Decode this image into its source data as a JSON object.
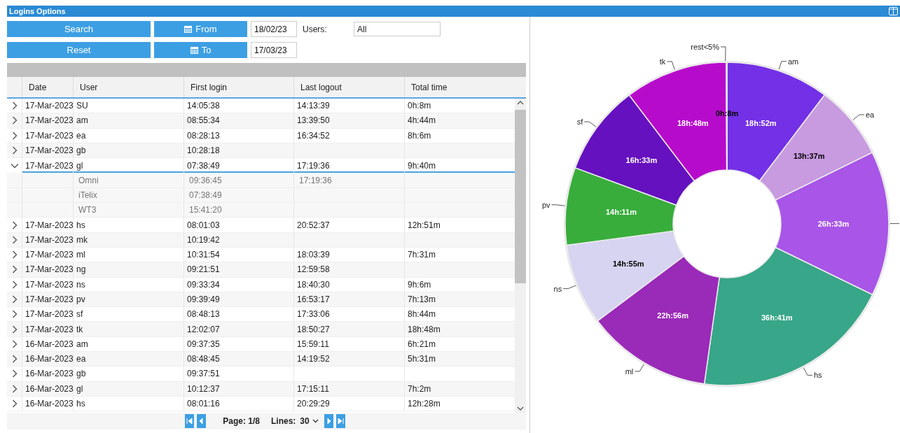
{
  "window": {
    "title": "Logins Options"
  },
  "filters": {
    "search_button": "Search",
    "reset_button": "Reset",
    "from_button": "From",
    "to_button": "To",
    "from_date": "18/02/23",
    "to_date": "17/03/23",
    "users_label": "Users:",
    "users_value": "All"
  },
  "table": {
    "columns": [
      "Date",
      "User",
      "First login",
      "Last logout",
      "Total time"
    ],
    "rows": [
      {
        "date": "17-Mar-2023",
        "user": "SU",
        "first_login": "14:05:38",
        "last_logout": "14:13:39",
        "total_time": "0h:8m",
        "expanded": false
      },
      {
        "date": "17-Mar-2023",
        "user": "am",
        "first_login": "08:55:34",
        "last_logout": "13:39:50",
        "total_time": "4h:44m",
        "expanded": false
      },
      {
        "date": "17-Mar-2023",
        "user": "ea",
        "first_login": "08:28:13",
        "last_logout": "16:34:52",
        "total_time": "8h:6m",
        "expanded": false
      },
      {
        "date": "17-Mar-2023",
        "user": "gb",
        "first_login": "10:28:18",
        "expanded": false
      },
      {
        "date": "17-Mar-2023",
        "user": "gl",
        "first_login": "07:38:49",
        "last_logout": "17:19:36",
        "total_time": "9h:40m",
        "expanded": true,
        "children": [
          {
            "user": "Omni",
            "first_login": "09:36:45",
            "last_logout": "17:19:36"
          },
          {
            "user": "iTelix",
            "first_login": "07:38:49"
          },
          {
            "user": "WT3",
            "first_login": "15:41:20"
          }
        ]
      },
      {
        "date": "17-Mar-2023",
        "user": "hs",
        "first_login": "08:01:03",
        "last_logout": "20:52:37",
        "total_time": "12h:51m",
        "expanded": false
      },
      {
        "date": "17-Mar-2023",
        "user": "mk",
        "first_login": "10:19:42",
        "expanded": false
      },
      {
        "date": "17-Mar-2023",
        "user": "ml",
        "first_login": "10:31:54",
        "last_logout": "18:03:39",
        "total_time": "7h:31m",
        "expanded": false
      },
      {
        "date": "17-Mar-2023",
        "user": "ng",
        "first_login": "09:21:51",
        "last_logout": "12:59:58",
        "expanded": false
      },
      {
        "date": "17-Mar-2023",
        "user": "ns",
        "first_login": "09:33:34",
        "last_logout": "18:40:30",
        "total_time": "9h:6m",
        "expanded": false
      },
      {
        "date": "17-Mar-2023",
        "user": "pv",
        "first_login": "09:39:49",
        "last_logout": "16:53:17",
        "total_time": "7h:13m",
        "expanded": false
      },
      {
        "date": "17-Mar-2023",
        "user": "sf",
        "first_login": "08:48:13",
        "last_logout": "17:33:06",
        "total_time": "8h:44m",
        "expanded": false
      },
      {
        "date": "17-Mar-2023",
        "user": "tk",
        "first_login": "12:02:07",
        "last_logout": "18:50:27",
        "total_time": "18h:48m",
        "expanded": false
      },
      {
        "date": "16-Mar-2023",
        "user": "am",
        "first_login": "09:37:35",
        "last_logout": "15:59:11",
        "total_time": "6h:21m",
        "expanded": false
      },
      {
        "date": "16-Mar-2023",
        "user": "ea",
        "first_login": "08:48:45",
        "last_logout": "14:19:52",
        "total_time": "5h:31m",
        "expanded": false
      },
      {
        "date": "16-Mar-2023",
        "user": "gb",
        "first_login": "09:37:51",
        "expanded": false
      },
      {
        "date": "16-Mar-2023",
        "user": "gl",
        "first_login": "10:12:37",
        "last_logout": "17:15:11",
        "total_time": "7h:2m",
        "expanded": false
      },
      {
        "date": "16-Mar-2023",
        "user": "hs",
        "first_login": "08:01:16",
        "last_logout": "20:29:29",
        "total_time": "12h:28m",
        "expanded": false
      }
    ]
  },
  "pager": {
    "page_label": "Page:",
    "page": "1/8",
    "lines_label": "Lines:",
    "lines": "30"
  },
  "chart_data": {
    "type": "donut",
    "categories": [
      "am",
      "ea",
      null,
      "hs",
      "ml",
      "ns",
      "pv",
      "sf",
      "tk",
      "rest<5%"
    ],
    "values": [
      10.3,
      7.43,
      14.49,
      20.02,
      12.52,
      8.14,
      7.74,
      9.03,
      10.26,
      0.07
    ],
    "annotations": [
      {
        "text": "18h:52m"
      },
      {
        "text": "13h:37m"
      },
      {
        "text": "26h:33m"
      },
      {
        "text": "36h:41m"
      },
      {
        "text": "22h:56m"
      },
      {
        "text": "14h:55m"
      },
      {
        "text": "14h:11m"
      },
      {
        "text": "16h:33m"
      },
      {
        "text": "18h:48m"
      },
      {
        "text": "0h:8m"
      }
    ],
    "colors": [
      "#7330e6",
      "#c89ae0",
      "#a855e8",
      "#38a688",
      "#9a2ab8",
      "#d6d4f0",
      "#38ad3c",
      "#6511bf",
      "#b70bcc",
      "#555555"
    ]
  }
}
